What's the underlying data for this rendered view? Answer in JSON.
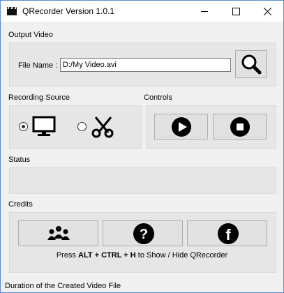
{
  "window": {
    "title": "QRecorder Version 1.0.1"
  },
  "output_video": {
    "section_label": "Output Video",
    "file_name_label": "File Name :",
    "file_name_value": "D:/My Video.avi"
  },
  "recording_source": {
    "section_label": "Recording Source",
    "options": [
      {
        "icon": "monitor-icon",
        "selected": true
      },
      {
        "icon": "scissors-icon",
        "selected": false
      }
    ]
  },
  "controls": {
    "section_label": "Controls",
    "buttons": [
      {
        "icon": "play-icon"
      },
      {
        "icon": "stop-icon"
      }
    ]
  },
  "status": {
    "section_label": "Status",
    "text": ""
  },
  "credits": {
    "section_label": "Credits",
    "buttons": [
      {
        "icon": "group-icon"
      },
      {
        "icon": "help-icon"
      },
      {
        "icon": "facebook-icon"
      }
    ],
    "hotkey": {
      "prefix": "Press ",
      "keys": "ALT + CTRL + H",
      "suffix": " to Show / Hide QRecorder"
    }
  },
  "footer": {
    "duration_label": "Duration of the Created Video File"
  }
}
